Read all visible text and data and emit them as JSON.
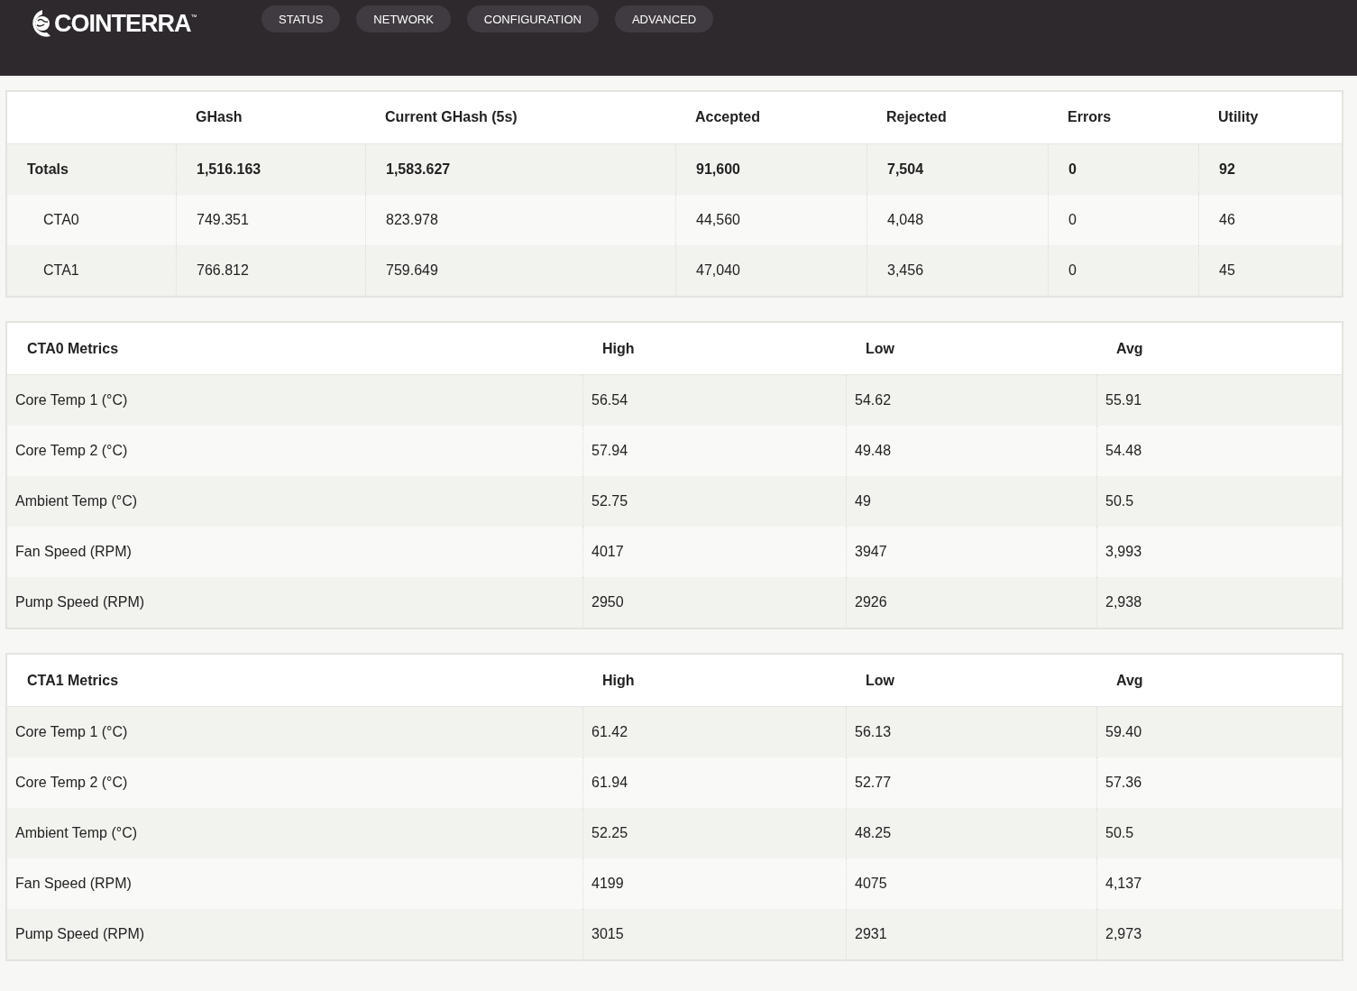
{
  "logo": {
    "text": "COINTERRA",
    "trademark": "™"
  },
  "nav": [
    {
      "label": "STATUS"
    },
    {
      "label": "NETWORK"
    },
    {
      "label": "CONFIGURATION"
    },
    {
      "label": "ADVANCED"
    }
  ],
  "summary": {
    "columns": [
      "",
      "GHash",
      "Current GHash (5s)",
      "Accepted",
      "Rejected",
      "Errors",
      "Utility"
    ],
    "rows": [
      {
        "kind": "total",
        "cells": [
          "Totals",
          "1,516.163",
          "1,583.627",
          "91,600",
          "7,504",
          "0",
          "92"
        ]
      },
      {
        "kind": "unit",
        "cells": [
          "CTA0",
          "749.351",
          "823.978",
          "44,560",
          "4,048",
          "0",
          "46"
        ]
      },
      {
        "kind": "unit",
        "cells": [
          "CTA1",
          "766.812",
          "759.649",
          "47,040",
          "3,456",
          "0",
          "45"
        ]
      }
    ]
  },
  "metrics": [
    {
      "title": "CTA0 Metrics",
      "columns": [
        "High",
        "Low",
        "Avg"
      ],
      "rows": [
        {
          "label": "Core Temp 1 (°C)",
          "values": [
            "56.54",
            "54.62",
            "55.91"
          ]
        },
        {
          "label": "Core Temp 2 (°C)",
          "values": [
            "57.94",
            "49.48",
            "54.48"
          ]
        },
        {
          "label": "Ambient Temp (°C)",
          "values": [
            "52.75",
            "49",
            "50.5"
          ]
        },
        {
          "label": "Fan Speed (RPM)",
          "values": [
            "4017",
            "3947",
            "3,993"
          ]
        },
        {
          "label": "Pump Speed (RPM)",
          "values": [
            "2950",
            "2926",
            "2,938"
          ]
        }
      ]
    },
    {
      "title": "CTA1 Metrics",
      "columns": [
        "High",
        "Low",
        "Avg"
      ],
      "rows": [
        {
          "label": "Core Temp 1 (°C)",
          "values": [
            "61.42",
            "56.13",
            "59.40"
          ]
        },
        {
          "label": "Core Temp 2 (°C)",
          "values": [
            "61.94",
            "52.77",
            "57.36"
          ]
        },
        {
          "label": "Ambient Temp (°C)",
          "values": [
            "52.25",
            "48.25",
            "50.5"
          ]
        },
        {
          "label": "Fan Speed (RPM)",
          "values": [
            "4199",
            "4075",
            "4,137"
          ]
        },
        {
          "label": "Pump Speed (RPM)",
          "values": [
            "3015",
            "2931",
            "2,973"
          ]
        }
      ]
    }
  ]
}
